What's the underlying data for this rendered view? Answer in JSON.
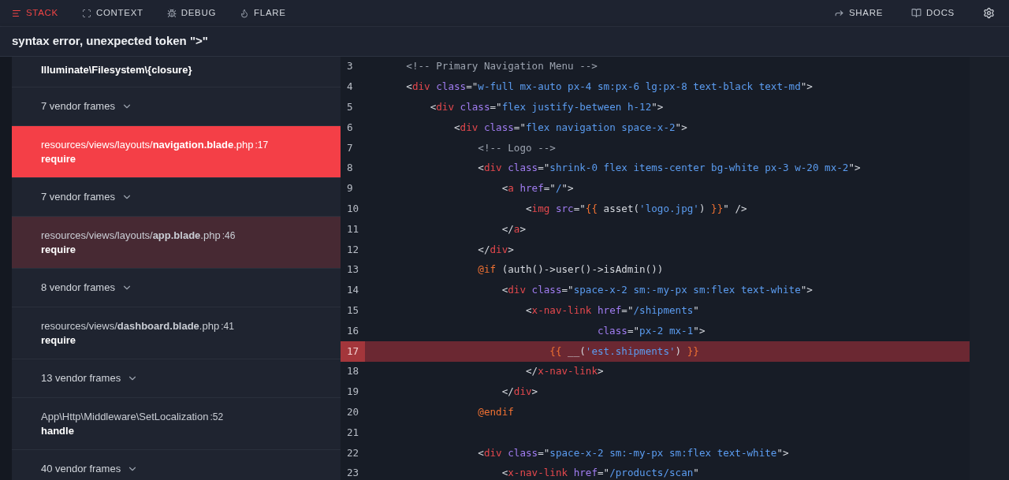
{
  "nav": {
    "tabs": [
      {
        "label": "STACK",
        "selected": true
      },
      {
        "label": "CONTEXT",
        "selected": false
      },
      {
        "label": "DEBUG",
        "selected": false
      },
      {
        "label": "FLARE",
        "selected": false
      }
    ],
    "actions": [
      {
        "label": "SHARE"
      },
      {
        "label": "DOCS"
      }
    ]
  },
  "error": {
    "message": "syntax error, unexpected token \">\""
  },
  "frames": [
    {
      "kind": "frame",
      "method": "Illuminate\\Filesystem\\{closure}",
      "selected": false,
      "highlighted": false
    },
    {
      "kind": "vendor",
      "label": "7 vendor frames",
      "expanded": false
    },
    {
      "kind": "frame",
      "path": "resources/views/layouts/**navigation.blade**.php",
      "line": ":17",
      "method": "require",
      "selected": true
    },
    {
      "kind": "vendor",
      "label": "7 vendor frames",
      "expanded": false
    },
    {
      "kind": "frame",
      "path": "resources/views/layouts/**app.blade**.php",
      "line": ":46",
      "method": "require",
      "selected": false,
      "highlighted": true
    },
    {
      "kind": "vendor",
      "label": "8 vendor frames",
      "expanded": false
    },
    {
      "kind": "frame",
      "path": "resources/views/**dashboard.blade**.php",
      "line": ":41",
      "method": "require",
      "selected": false,
      "highlighted": false
    },
    {
      "kind": "vendor",
      "label": "13 vendor frames",
      "expanded": false
    },
    {
      "kind": "frame",
      "path": "App\\Http\\Middleware\\SetLocalization",
      "line": ":52",
      "method": "handle",
      "selected": false,
      "highlighted": false
    },
    {
      "kind": "vendor",
      "label": "40 vendor frames",
      "expanded": false
    }
  ],
  "code": {
    "lines": [
      {
        "number": "3",
        "highlighted": false,
        "tokens": [
          {
            "kind": "comment",
            "text": "    <!-- Primary Navigation Menu -->"
          }
        ]
      },
      {
        "number": "4",
        "highlighted": false,
        "tokens": [
          {
            "kind": "text",
            "text": "    <"
          },
          {
            "kind": "tag",
            "text": "div"
          },
          {
            "kind": "attr",
            "text": " class"
          },
          {
            "kind": "text",
            "text": "=\""
          },
          {
            "kind": "string",
            "text": "w-full mx-auto px-4 sm:px-6 lg:px-8 text-black text-md"
          },
          {
            "kind": "text",
            "text": "\">"
          }
        ]
      },
      {
        "number": "5",
        "highlighted": false,
        "tokens": [
          {
            "kind": "text",
            "text": "        <"
          },
          {
            "kind": "tag",
            "text": "div"
          },
          {
            "kind": "attr",
            "text": " class"
          },
          {
            "kind": "text",
            "text": "=\""
          },
          {
            "kind": "string",
            "text": "flex justify-between h-12"
          },
          {
            "kind": "text",
            "text": "\">"
          }
        ]
      },
      {
        "number": "6",
        "highlighted": false,
        "tokens": [
          {
            "kind": "text",
            "text": "            <"
          },
          {
            "kind": "tag",
            "text": "div"
          },
          {
            "kind": "attr",
            "text": " class"
          },
          {
            "kind": "text",
            "text": "=\""
          },
          {
            "kind": "string",
            "text": "flex navigation space-x-2"
          },
          {
            "kind": "text",
            "text": "\">"
          }
        ]
      },
      {
        "number": "7",
        "highlighted": false,
        "tokens": [
          {
            "kind": "comment",
            "text": "                <!-- Logo -->"
          }
        ]
      },
      {
        "number": "8",
        "highlighted": false,
        "tokens": [
          {
            "kind": "text",
            "text": "                <"
          },
          {
            "kind": "tag",
            "text": "div"
          },
          {
            "kind": "attr",
            "text": " class"
          },
          {
            "kind": "text",
            "text": "=\""
          },
          {
            "kind": "string",
            "text": "shrink-0 flex items-center bg-white px-3 w-20 mx-2"
          },
          {
            "kind": "text",
            "text": "\">"
          }
        ]
      },
      {
        "number": "9",
        "highlighted": false,
        "tokens": [
          {
            "kind": "text",
            "text": "                    <"
          },
          {
            "kind": "tag",
            "text": "a"
          },
          {
            "kind": "attr",
            "text": " href"
          },
          {
            "kind": "text",
            "text": "=\""
          },
          {
            "kind": "string",
            "text": "/"
          },
          {
            "kind": "text",
            "text": "\">"
          }
        ]
      },
      {
        "number": "10",
        "highlighted": false,
        "tokens": [
          {
            "kind": "text",
            "text": "                        <"
          },
          {
            "kind": "tag",
            "text": "img"
          },
          {
            "kind": "attr",
            "text": " src"
          },
          {
            "kind": "text",
            "text": "=\""
          },
          {
            "kind": "blade",
            "text": "{{"
          },
          {
            "kind": "text",
            "text": " asset("
          },
          {
            "kind": "string",
            "text": "'logo.jpg'"
          },
          {
            "kind": "text",
            "text": ") "
          },
          {
            "kind": "blade",
            "text": "}}"
          },
          {
            "kind": "text",
            "text": "\" />"
          }
        ]
      },
      {
        "number": "11",
        "highlighted": false,
        "tokens": [
          {
            "kind": "text",
            "text": "                    </"
          },
          {
            "kind": "tag",
            "text": "a"
          },
          {
            "kind": "text",
            "text": ">"
          }
        ]
      },
      {
        "number": "12",
        "highlighted": false,
        "tokens": [
          {
            "kind": "text",
            "text": "                </"
          },
          {
            "kind": "tag",
            "text": "div"
          },
          {
            "kind": "text",
            "text": ">"
          }
        ]
      },
      {
        "number": "13",
        "highlighted": false,
        "tokens": [
          {
            "kind": "blade",
            "text": "                @if"
          },
          {
            "kind": "text",
            "text": " (auth()->user()->isAdmin())"
          }
        ]
      },
      {
        "number": "14",
        "highlighted": false,
        "tokens": [
          {
            "kind": "text",
            "text": "                    <"
          },
          {
            "kind": "tag",
            "text": "div"
          },
          {
            "kind": "attr",
            "text": " class"
          },
          {
            "kind": "text",
            "text": "=\""
          },
          {
            "kind": "string",
            "text": "space-x-2 sm:-my-px sm:flex text-white"
          },
          {
            "kind": "text",
            "text": "\">"
          }
        ]
      },
      {
        "number": "15",
        "highlighted": false,
        "tokens": [
          {
            "kind": "text",
            "text": "                        <"
          },
          {
            "kind": "tag",
            "text": "x-nav-link"
          },
          {
            "kind": "attr",
            "text": " href"
          },
          {
            "kind": "text",
            "text": "=\""
          },
          {
            "kind": "string",
            "text": "/shipments"
          },
          {
            "kind": "text",
            "text": "\""
          }
        ]
      },
      {
        "number": "16",
        "highlighted": false,
        "tokens": [
          {
            "kind": "attr",
            "text": "                                    class"
          },
          {
            "kind": "text",
            "text": "=\""
          },
          {
            "kind": "string",
            "text": "px-2 mx-1"
          },
          {
            "kind": "text",
            "text": "\">"
          }
        ]
      },
      {
        "number": "17",
        "highlighted": true,
        "tokens": [
          {
            "kind": "blade",
            "text": "                            {{"
          },
          {
            "kind": "text",
            "text": " __("
          },
          {
            "kind": "string",
            "text": "'est.shipments'"
          },
          {
            "kind": "text",
            "text": ") "
          },
          {
            "kind": "blade",
            "text": "}}"
          }
        ]
      },
      {
        "number": "18",
        "highlighted": false,
        "tokens": [
          {
            "kind": "text",
            "text": "                        </"
          },
          {
            "kind": "tag",
            "text": "x-nav-link"
          },
          {
            "kind": "text",
            "text": ">"
          }
        ]
      },
      {
        "number": "19",
        "highlighted": false,
        "tokens": [
          {
            "kind": "text",
            "text": "                    </"
          },
          {
            "kind": "tag",
            "text": "div"
          },
          {
            "kind": "text",
            "text": ">"
          }
        ]
      },
      {
        "number": "20",
        "highlighted": false,
        "tokens": [
          {
            "kind": "blade",
            "text": "                @endif"
          }
        ]
      },
      {
        "number": "21",
        "highlighted": false
      },
      {
        "number": "22",
        "highlighted": false,
        "tokens": [
          {
            "kind": "text",
            "text": "                <"
          },
          {
            "kind": "tag",
            "text": "div"
          },
          {
            "kind": "attr",
            "text": " class"
          },
          {
            "kind": "text",
            "text": "=\""
          },
          {
            "kind": "string",
            "text": "space-x-2 sm:-my-px sm:flex text-white"
          },
          {
            "kind": "text",
            "text": "\">"
          }
        ]
      },
      {
        "number": "23",
        "highlighted": false,
        "tokens": [
          {
            "kind": "text",
            "text": "                    <"
          },
          {
            "kind": "tag",
            "text": "x-nav-link"
          },
          {
            "kind": "attr",
            "text": " href"
          },
          {
            "kind": "text",
            "text": "=\""
          },
          {
            "kind": "string",
            "text": "/products/scan"
          },
          {
            "kind": "text",
            "text": "\""
          }
        ]
      }
    ]
  }
}
